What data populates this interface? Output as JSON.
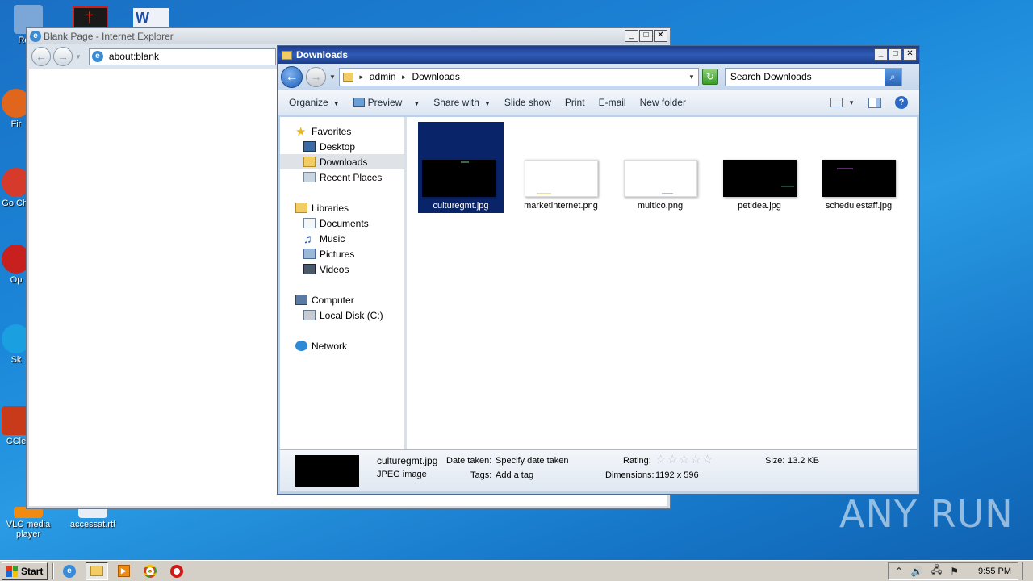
{
  "desktop": {
    "icons": [
      {
        "label": "Recy",
        "color": "#7aa6d8"
      },
      {
        "label": "Fir",
        "color": "#e0661e"
      },
      {
        "label": "Go Chr",
        "color": "#d63a2a"
      },
      {
        "label": "Op",
        "color": "#c8201e"
      },
      {
        "label": "Sk",
        "color": "#1aa0e0"
      },
      {
        "label": "CCle",
        "color": "#c83a1a"
      },
      {
        "label": "VLC media player",
        "color": "#f08a10"
      },
      {
        "label": "accessat.rtf",
        "color": "#e8eef6"
      }
    ],
    "watermark": "ANY RUN"
  },
  "ie_window": {
    "title": "Blank Page - Internet Explorer",
    "address": "about:blank"
  },
  "explorer": {
    "title": "Downloads",
    "breadcrumb": [
      "admin",
      "Downloads"
    ],
    "search_placeholder": "Search Downloads",
    "toolbar": {
      "organize": "Organize",
      "preview": "Preview",
      "share_with": "Share with",
      "slide_show": "Slide show",
      "print": "Print",
      "email": "E-mail",
      "new_folder": "New folder"
    },
    "nav": {
      "favorites": "Favorites",
      "desktop": "Desktop",
      "downloads": "Downloads",
      "recent_places": "Recent Places",
      "libraries": "Libraries",
      "documents": "Documents",
      "music": "Music",
      "pictures": "Pictures",
      "videos": "Videos",
      "computer": "Computer",
      "local_disk": "Local Disk (C:)",
      "network": "Network"
    },
    "files": [
      {
        "name": "culturegmt.jpg",
        "thumb": "black",
        "selected": true
      },
      {
        "name": "marketinternet.png",
        "thumb": "white",
        "selected": false
      },
      {
        "name": "multico.png",
        "thumb": "white",
        "selected": false
      },
      {
        "name": "petidea.jpg",
        "thumb": "black",
        "selected": false
      },
      {
        "name": "schedulestaff.jpg",
        "thumb": "black",
        "selected": false
      }
    ],
    "details": {
      "name": "culturegmt.jpg",
      "type": "JPEG image",
      "date_taken_label": "Date taken:",
      "date_taken_value": "Specify date taken",
      "tags_label": "Tags:",
      "tags_value": "Add a tag",
      "rating_label": "Rating:",
      "dimensions_label": "Dimensions:",
      "dimensions_value": "1192 x 596",
      "size_label": "Size:",
      "size_value": "13.2 KB"
    }
  },
  "taskbar": {
    "start": "Start",
    "clock": "9:55 PM"
  }
}
